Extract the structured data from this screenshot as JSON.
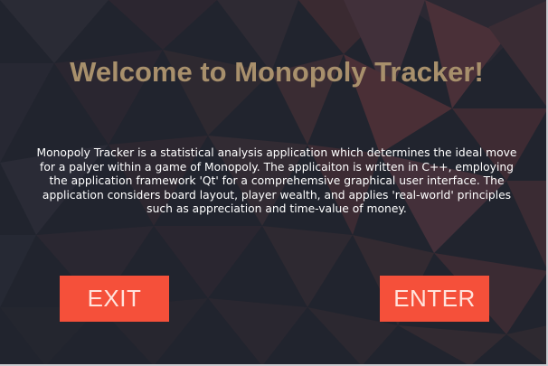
{
  "window": {
    "title": "Welcome to Monopoly Tracker!",
    "description": "Monopoly Tracker is a statistical analysis application which determines the ideal move for a palyer within a game of Monopoly. The applicaiton is written in C++, employing the application framework 'Qt' for a comprehemsive graphical user interface. The application considers board layout, player wealth, and applies 'real-world' principles such as appreciation and time-value of money."
  },
  "buttons": {
    "exit_label": "EXIT",
    "enter_label": "ENTER"
  },
  "colors": {
    "title": "#a8906c",
    "button": "#f5503a",
    "button_text": "#ffe3dc",
    "background": "#1f222c"
  }
}
